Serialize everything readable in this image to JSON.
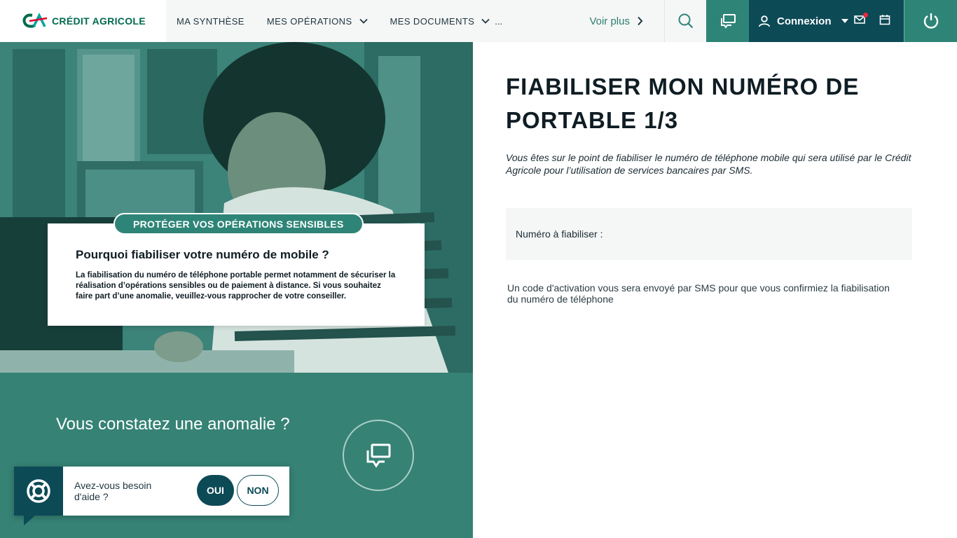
{
  "header": {
    "logo_text": "CRÉDIT AGRICOLE",
    "nav": [
      {
        "label": "MA SYNTHÈSE"
      },
      {
        "label": "MES OPÉRATIONS"
      },
      {
        "label": "MES DOCUMENTS"
      }
    ],
    "nav_more": "...",
    "voir_plus": "Voir plus",
    "account_label": "Connexion",
    "icons": [
      "ca-logo-icon",
      "chevron-down-icon",
      "chevron-right-icon",
      "search-icon",
      "chat-icon",
      "user-icon",
      "caret-down-icon",
      "mail-icon",
      "calendar-icon",
      "power-icon"
    ]
  },
  "hero": {
    "tag": "PROTÉGER VOS OPÉRATIONS SENSIBLES",
    "card_title": "Pourquoi fiabiliser votre numéro de mobile ?",
    "card_text": "La fiabilisation du numéro de téléphone portable permet notamment de sécuriser la réalisation d’opérations sensibles ou de paiement à distance. Si vous souhaitez faire part d’une anomalie, veuillez-vous rapprocher de votre conseiller."
  },
  "anomaly": {
    "title": "Vous constatez une anomalie ?"
  },
  "help": {
    "text": "Avez-vous besoin d'aide ?",
    "yes": "OUI",
    "no": "NON"
  },
  "main": {
    "title": "FIABILISER MON NUMÉRO DE PORTABLE 1/3",
    "intro": "Vous êtes sur le point de fiabiliser le numéro de téléphone mobile qui sera utilisé par le Crédit Agricole pour l’utilisation de services bancaires par SMS.",
    "number_label": "Numéro à fiabiliser :",
    "note": "Un code d'activation vous sera envoyé par SMS pour que vous confirmiez la fiabilisation du numéro de téléphone"
  },
  "colors": {
    "brand_green": "#2e8577",
    "dark_teal": "#0c4a56",
    "notification_red": "#e8283c"
  }
}
